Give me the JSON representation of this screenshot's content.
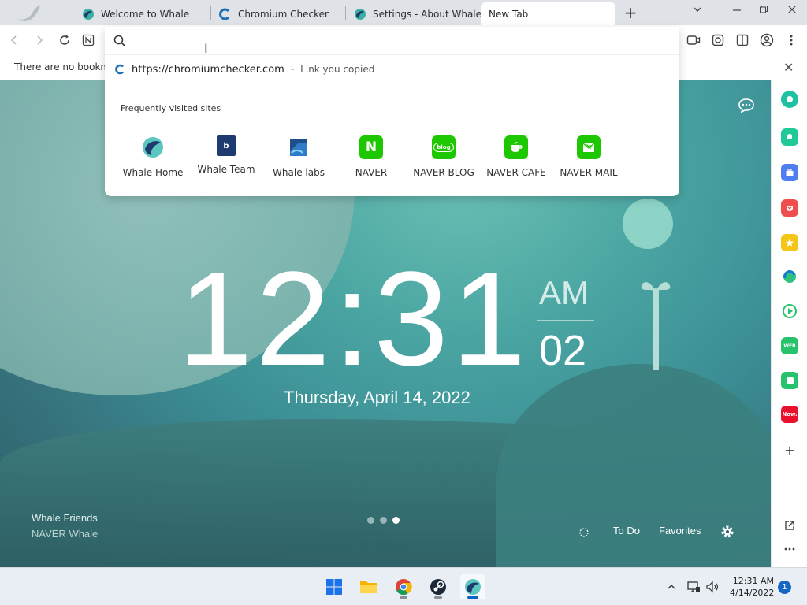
{
  "tabs": [
    {
      "label": "Welcome to Whale"
    },
    {
      "label": "Chromium Checker"
    },
    {
      "label": "Settings - About Whale"
    },
    {
      "label": "New Tab"
    }
  ],
  "bookmarks_bar": {
    "message": "There are no bookma"
  },
  "omnibox": {
    "suggestion_url": "https://chromiumchecker.com",
    "suggestion_sep": "-",
    "suggestion_desc": "Link you copied",
    "frequent_title": "Frequently visited sites",
    "sites": [
      {
        "name": "Whale Home"
      },
      {
        "name": "Whale Team",
        "glyph": "b"
      },
      {
        "name": "Whale labs"
      },
      {
        "name": "NAVER",
        "glyph": "N"
      },
      {
        "name": "NAVER BLOG",
        "glyph": "blog"
      },
      {
        "name": "NAVER CAFE"
      },
      {
        "name": "NAVER MAIL"
      }
    ]
  },
  "ntp": {
    "time": "12:31",
    "ampm": "AM",
    "seconds": "02",
    "date": "Thursday, April 14, 2022",
    "friends_title": "Whale Friends",
    "friends_sub": "NAVER Whale",
    "todo": "To Do",
    "favorites": "Favorites"
  },
  "sidebar": {
    "now_label": "Now."
  },
  "taskbar": {
    "time": "12:31 AM",
    "date": "4/14/2022",
    "notifications": "1"
  },
  "colors": {
    "naver_green": "#1ec800",
    "whale_navy": "#1f3a6e",
    "ntp_teal": "#4aa5a2",
    "accent_blue": "#0a64c8"
  }
}
